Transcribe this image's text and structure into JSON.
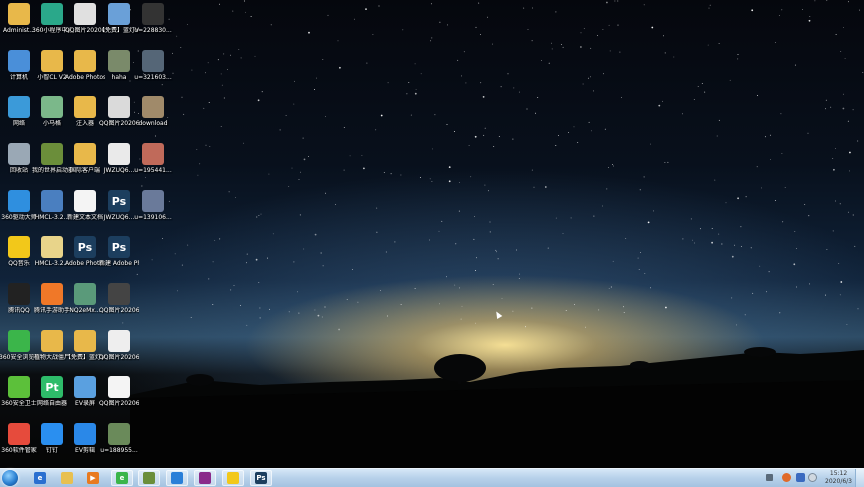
{
  "desktop": {
    "icons": [
      {
        "label": "Administ...",
        "icon": "folder-icon",
        "color": "#e8b84a"
      },
      {
        "label": "计算机",
        "icon": "computer-icon",
        "color": "#4a8fd9"
      },
      {
        "label": "网络",
        "icon": "network-icon",
        "color": "#3b9ad9"
      },
      {
        "label": "回收站",
        "icon": "recycle-bin-icon",
        "color": "#9aa8b5"
      },
      {
        "label": "360驱动大师",
        "icon": "driver-master-icon",
        "color": "#2f8fdf"
      },
      {
        "label": "QQ音乐",
        "icon": "qq-music-icon",
        "color": "#f2c81a"
      },
      {
        "label": "腾讯QQ",
        "icon": "qq-icon",
        "color": "#222222"
      },
      {
        "label": "360安全浏览器",
        "icon": "browser-icon",
        "color": "#3bb54a"
      },
      {
        "label": "360安全卫士",
        "icon": "security-guard-icon",
        "color": "#5cc03a"
      },
      {
        "label": "360软件管家",
        "icon": "software-manager-icon",
        "color": "#e64b3c"
      },
      {
        "label": "360小程序中心",
        "icon": "miniapp-icon",
        "color": "#2aa88a"
      },
      {
        "label": "小智CL V2",
        "icon": "folder-icon",
        "color": "#e8b84a"
      },
      {
        "label": "小马格",
        "icon": "map-icon",
        "color": "#7bb88a"
      },
      {
        "label": "我的世界启动器",
        "icon": "minecraft-icon",
        "color": "#6b8e3a"
      },
      {
        "label": "HMCL-3.2...",
        "icon": "hmcl-icon",
        "color": "#4a7fc0"
      },
      {
        "label": "HMCL-3.2...",
        "icon": "folder-icon",
        "color": "#e8d48a"
      },
      {
        "label": "腾讯手游助手",
        "icon": "game-helper-icon",
        "color": "#f07828"
      },
      {
        "label": "植物大战僵尸",
        "icon": "folder-icon",
        "color": "#e8b84a"
      },
      {
        "label": "网络自由器",
        "icon": "pt-icon",
        "color": "#2ebc6a"
      },
      {
        "label": "钉钉",
        "icon": "dingtalk-icon",
        "color": "#2a8ff0"
      },
      {
        "label": "QQ图片2020060...",
        "icon": "image-icon",
        "color": "#e0e0e0"
      },
      {
        "label": "Adobe Photosh...",
        "icon": "folder-icon",
        "color": "#e8b84a"
      },
      {
        "label": "注入器",
        "icon": "folder-icon",
        "color": "#e8b84a"
      },
      {
        "label": "国际客户端",
        "icon": "folder-icon",
        "color": "#e8b84a"
      },
      {
        "label": "新建文本文档",
        "icon": "text-file-icon",
        "color": "#f4f4f4"
      },
      {
        "label": "Adobe Photosh...",
        "icon": "photoshop-icon",
        "color": "#1c3e5e"
      },
      {
        "label": "NQ2eMx...",
        "icon": "image-icon",
        "color": "#5a9a7a"
      },
      {
        "label": "【免费】蓝灯VPN",
        "icon": "folder-icon",
        "color": "#e8b84a"
      },
      {
        "label": "EV录屏",
        "icon": "ev-recorder-icon",
        "color": "#5aa0e0"
      },
      {
        "label": "EV剪辑",
        "icon": "ev-editor-icon",
        "color": "#2a88e8"
      },
      {
        "label": "【免费】蓝灯VPN",
        "icon": "folder-icon",
        "color": "#6aa0d8"
      },
      {
        "label": "haha",
        "icon": "image-icon",
        "color": "#7a8a6a"
      },
      {
        "label": "QQ图片2020602...",
        "icon": "image-icon",
        "color": "#dadada"
      },
      {
        "label": "JWZUQ6...",
        "icon": "image-icon",
        "color": "#eaeaea"
      },
      {
        "label": "JWZUQ6...",
        "icon": "photoshop-icon",
        "color": "#1c3e5e"
      },
      {
        "label": "新建 Adobe Photosho...",
        "icon": "photoshop-icon",
        "color": "#1c3e5e"
      },
      {
        "label": "QQ图片2020602...",
        "icon": "image-icon",
        "color": "#444444"
      },
      {
        "label": "QQ图片2020603...",
        "icon": "image-icon",
        "color": "#eeeeee"
      },
      {
        "label": "QQ图片2020603...",
        "icon": "image-icon",
        "color": "#f4f4f4"
      },
      {
        "label": "u=188955...",
        "icon": "image-icon",
        "color": "#6a8a5a"
      },
      {
        "label": "u=228830...",
        "icon": "image-icon",
        "color": "#333333"
      },
      {
        "label": "u=321603...",
        "icon": "image-icon",
        "color": "#556677"
      },
      {
        "label": "download",
        "icon": "image-icon",
        "color": "#a08a6a"
      },
      {
        "label": "u=195441...",
        "icon": "image-icon",
        "color": "#c06a5a"
      },
      {
        "label": "u=139106...",
        "icon": "image-icon",
        "color": "#6a7a9a"
      }
    ]
  },
  "taskbar": {
    "items": [
      {
        "name": "ie-icon",
        "color": "#2a6fd0",
        "glyph": "e"
      },
      {
        "name": "explorer-icon",
        "color": "#e8c050",
        "glyph": ""
      },
      {
        "name": "media-player-icon",
        "color": "#e87a20",
        "glyph": "▶"
      },
      {
        "name": "360-browser-icon",
        "color": "#3bb54a",
        "glyph": "e"
      },
      {
        "name": "minecraft-icon",
        "color": "#6b8e3a",
        "glyph": ""
      },
      {
        "name": "feather-icon",
        "color": "#2a7fd8",
        "glyph": ""
      },
      {
        "name": "game-icon",
        "color": "#8a2a8a",
        "glyph": ""
      },
      {
        "name": "qq-music-icon",
        "color": "#f2c81a",
        "glyph": ""
      },
      {
        "name": "photoshop-icon",
        "color": "#1c3e5e",
        "glyph": "Ps"
      }
    ],
    "clock_time": "15:12",
    "clock_date": "2020/6/3"
  }
}
